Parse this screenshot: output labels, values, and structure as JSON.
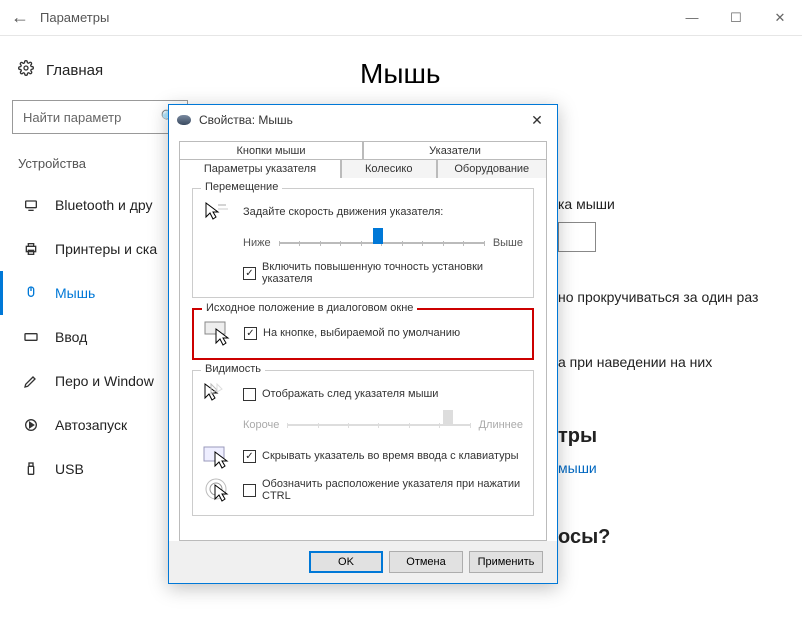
{
  "window": {
    "title": "Параметры",
    "min": "—",
    "max": "☐",
    "close": "✕"
  },
  "home_label": "Главная",
  "search_placeholder": "Найти параметр",
  "category": "Устройства",
  "nav": [
    {
      "label": "Bluetooth и дру"
    },
    {
      "label": "Принтеры и ска"
    },
    {
      "label": "Мышь"
    },
    {
      "label": "Ввод"
    },
    {
      "label": "Перо и Window"
    },
    {
      "label": "Автозапуск"
    },
    {
      "label": "USB"
    }
  ],
  "page_title": "Мышь",
  "peek": {
    "p1": "ка мыши",
    "p2": "но прокручиваться за один раз",
    "p3": "а при наведении на них",
    "p4": "тры",
    "p5": "мыши",
    "p6": "осы?"
  },
  "dialog": {
    "title": "Свойства: Мышь",
    "close": "✕",
    "tabs_row1": [
      "Кнопки мыши",
      "Указатели"
    ],
    "tabs_row2": [
      "Параметры указателя",
      "Колесико",
      "Оборудование"
    ],
    "group_move": {
      "legend": "Перемещение",
      "instr": "Задайте скорость движения указателя:",
      "slow": "Ниже",
      "fast": "Выше",
      "enhance": "Включить повышенную точность установки указателя"
    },
    "group_snap": {
      "legend": "Исходное положение в диалоговом окне",
      "label": "На кнопке, выбираемой по умолчанию"
    },
    "group_vis": {
      "legend": "Видимость",
      "trail": "Отображать след указателя мыши",
      "short": "Короче",
      "long": "Длиннее",
      "hide": "Скрывать указатель во время ввода с клавиатуры",
      "ctrl": "Обозначить расположение указателя при нажатии CTRL"
    },
    "buttons": {
      "ok": "OK",
      "cancel": "Отмена",
      "apply": "Применить"
    }
  }
}
